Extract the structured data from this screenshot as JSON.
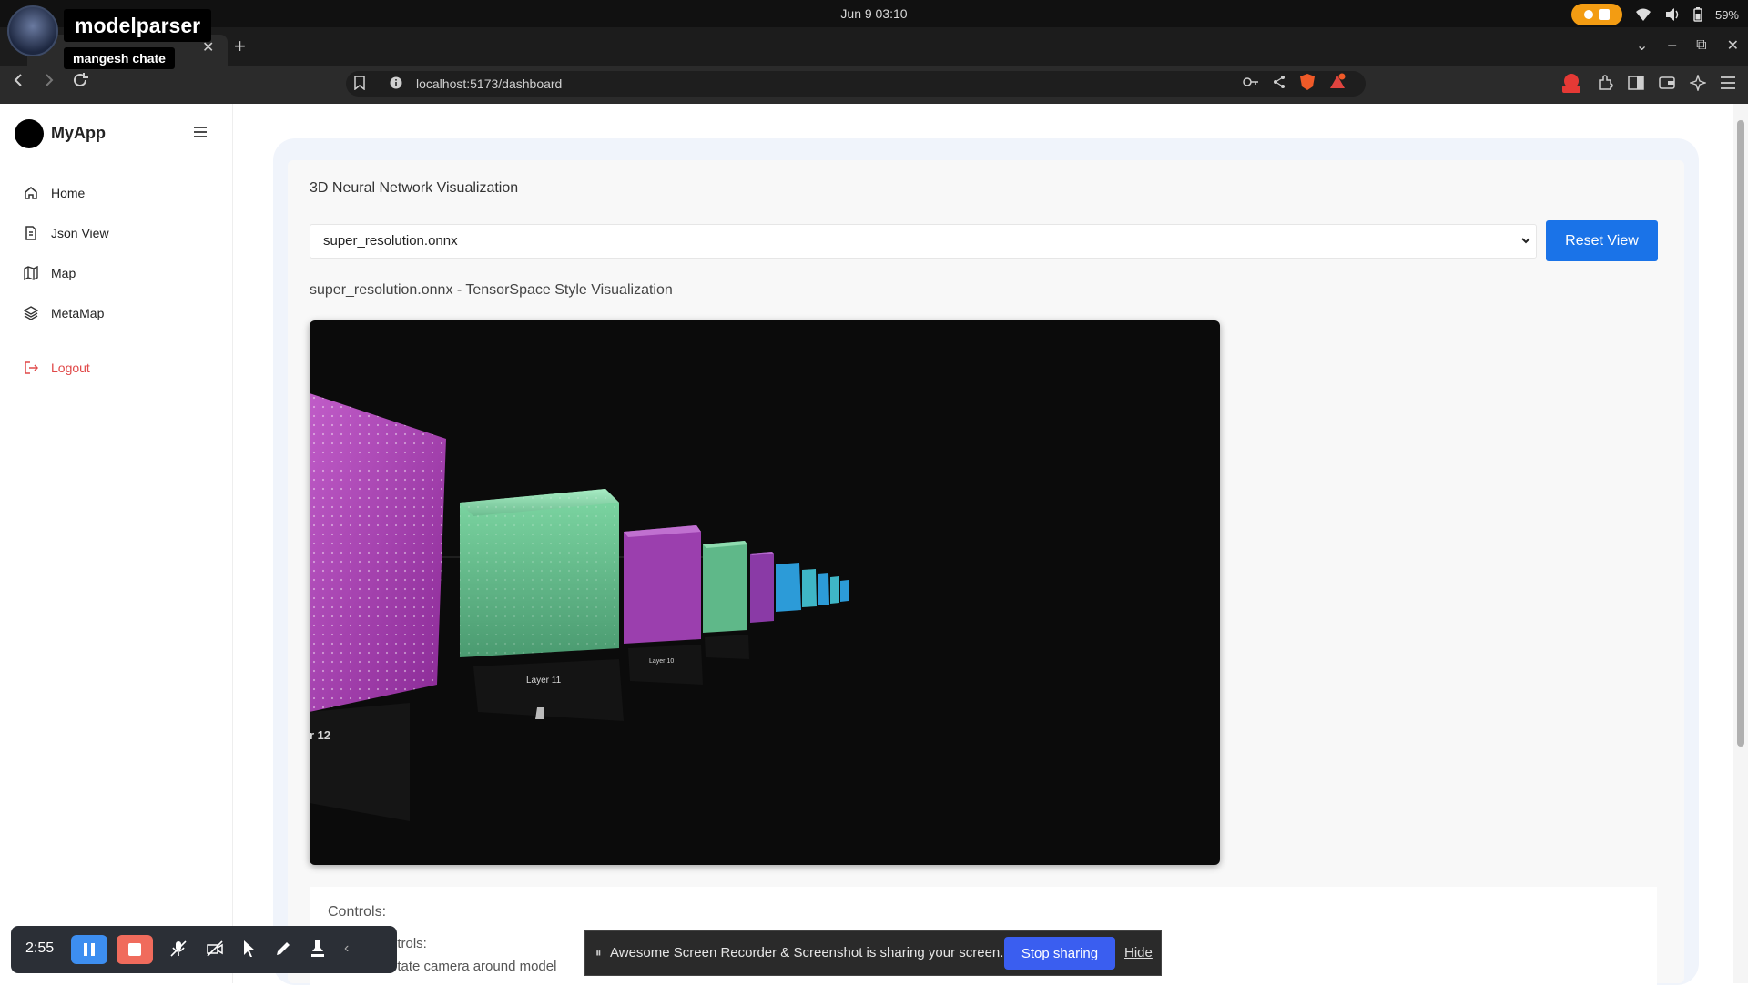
{
  "os": {
    "clock": "Jun 9  03:10",
    "battery": "59%",
    "accent_color": "#f39c12"
  },
  "overlay": {
    "channel_name": "modelparser",
    "channel_subtitle": "mangesh chate"
  },
  "browser": {
    "new_tab_symbol": "+",
    "url": "localhost:5173/dashboard",
    "icons": [
      "back-icon",
      "forward-icon",
      "reload-icon",
      "bookmark-icon",
      "info-icon",
      "key-icon",
      "share-icon",
      "brave-shield-icon",
      "brave-rewards-icon",
      "extensions-icon",
      "sidebar-icon",
      "wallet-icon",
      "leo-icon",
      "menu-icon"
    ]
  },
  "sidebar": {
    "app_name": "MyApp",
    "items": [
      {
        "label": "Home",
        "icon": "home-icon"
      },
      {
        "label": "Json View",
        "icon": "document-icon"
      },
      {
        "label": "Map",
        "icon": "map-icon"
      },
      {
        "label": "MetaMap",
        "icon": "layers-icon"
      }
    ],
    "logout_label": "Logout",
    "logout_color": "#e04848"
  },
  "main": {
    "title": "3D Neural Network Visualization",
    "selected_model": "super_resolution.onnx",
    "reset_label": "Reset View",
    "reset_color": "#1a73e8",
    "caption": "super_resolution.onnx - TensorSpace Style Visualization",
    "viz_labels": {
      "layer_main": "Layer 11",
      "layer_left": "r 12",
      "layer_second": "Layer 10"
    },
    "controls_title": "Controls:",
    "controls_line1": "ntrols:",
    "controls_line2": "otate camera around model"
  },
  "recorder": {
    "timer": "2:55",
    "pause_color": "#3d8ef0",
    "stop_color": "#f06b5c"
  },
  "share_bar": {
    "message": "Awesome Screen Recorder & Screenshot is sharing your screen.",
    "stop_label": "Stop sharing",
    "hide_label": "Hide",
    "stop_color": "#3a5ef0"
  }
}
